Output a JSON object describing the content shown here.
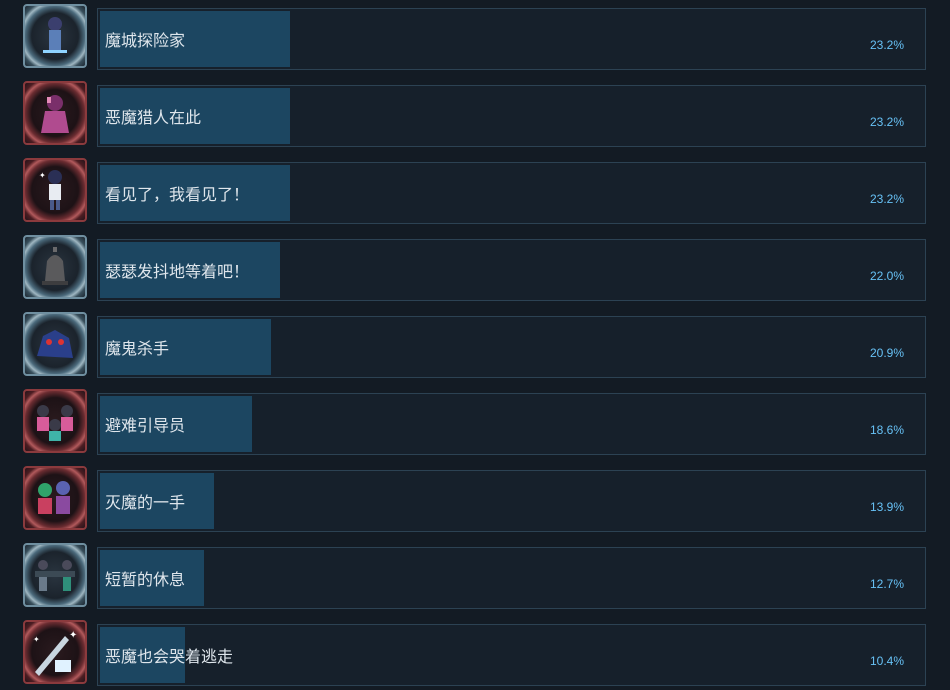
{
  "achievements": [
    {
      "name": "魔城探险家",
      "percent": "23.2%",
      "value": 23.2,
      "frame": "blue",
      "icon": "character-icon"
    },
    {
      "name": "恶魔猎人在此",
      "percent": "23.2%",
      "value": 23.2,
      "frame": "red",
      "icon": "demon-character-icon"
    },
    {
      "name": "看见了，我看见了！",
      "percent": "23.2%",
      "value": 23.2,
      "frame": "red",
      "icon": "boy-character-icon"
    },
    {
      "name": "瑟瑟发抖地等着吧！",
      "percent": "22.0%",
      "value": 22.0,
      "frame": "blue",
      "icon": "bell-icon"
    },
    {
      "name": "魔鬼杀手",
      "percent": "20.9%",
      "value": 20.9,
      "frame": "blue",
      "icon": "beast-icon"
    },
    {
      "name": "避难引导员",
      "percent": "18.6%",
      "value": 18.6,
      "frame": "red",
      "icon": "group-characters-icon"
    },
    {
      "name": "灭魔的一手",
      "percent": "13.9%",
      "value": 13.9,
      "frame": "red",
      "icon": "party-characters-icon"
    },
    {
      "name": "短暂的休息",
      "percent": "12.7%",
      "value": 12.7,
      "frame": "blue",
      "icon": "resting-characters-icon"
    },
    {
      "name": "恶魔也会哭着逃走",
      "percent": "10.4%",
      "value": 10.4,
      "frame": "red",
      "icon": "sword-icon"
    }
  ],
  "colors": {
    "fill": "#1c4661",
    "percent_text": "#67c1f5",
    "name_text": "#dfe6ec",
    "background": "#131b24"
  }
}
